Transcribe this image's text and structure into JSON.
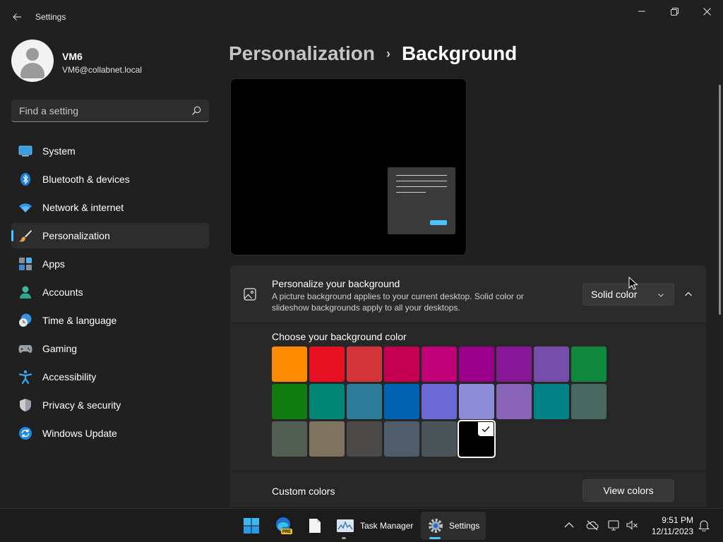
{
  "window": {
    "app_title": "Settings"
  },
  "user": {
    "name": "VM6",
    "email": "VM6@collabnet.local"
  },
  "search": {
    "placeholder": "Find a setting"
  },
  "nav": {
    "items": [
      {
        "label": "System",
        "icon": "system-icon"
      },
      {
        "label": "Bluetooth & devices",
        "icon": "bluetooth-icon"
      },
      {
        "label": "Network & internet",
        "icon": "wifi-icon"
      },
      {
        "label": "Personalization",
        "icon": "paintbrush-icon",
        "active": true
      },
      {
        "label": "Apps",
        "icon": "apps-icon"
      },
      {
        "label": "Accounts",
        "icon": "accounts-icon"
      },
      {
        "label": "Time & language",
        "icon": "time-language-icon"
      },
      {
        "label": "Gaming",
        "icon": "gamepad-icon"
      },
      {
        "label": "Accessibility",
        "icon": "accessibility-icon"
      },
      {
        "label": "Privacy & security",
        "icon": "shield-icon"
      },
      {
        "label": "Windows Update",
        "icon": "windows-update-icon"
      }
    ]
  },
  "breadcrumb": {
    "parent": "Personalization",
    "separator": "›",
    "current": "Background"
  },
  "background_card": {
    "title": "Personalize your background",
    "description": "A picture background applies to your current desktop. Solid color or slideshow backgrounds apply to all your desktops.",
    "dropdown_value": "Solid color"
  },
  "colors": {
    "title": "Choose your background color",
    "swatches": [
      "#ff8c00",
      "#e81123",
      "#d13438",
      "#c30052",
      "#bf0077",
      "#9a0089",
      "#881798",
      "#744da9",
      "#10893e",
      "#107c10",
      "#018574",
      "#2d7d9a",
      "#0063b1",
      "#6b69d6",
      "#8e8cd8",
      "#8764b8",
      "#038387",
      "#486860",
      "#525e54",
      "#7e735f",
      "#4c4a48",
      "#515c6b",
      "#4a5459",
      "#000000"
    ],
    "selected": "#000000"
  },
  "custom_colors": {
    "label": "Custom colors",
    "button": "View colors"
  },
  "taskbar": {
    "apps": [
      {
        "name": "Start",
        "icon": "windows-start-icon"
      },
      {
        "name": "Microsoft Edge Preview",
        "icon": "edge-pre-icon"
      },
      {
        "name": "File",
        "icon": "file-icon"
      },
      {
        "name": "Task Manager",
        "icon": "task-manager-icon"
      },
      {
        "name": "Settings",
        "icon": "settings-gear-icon"
      }
    ],
    "task_manager_label": "Task Manager",
    "settings_label": "Settings",
    "edge_badge": "PRE",
    "time": "9:51 PM",
    "date": "12/11/2023"
  }
}
